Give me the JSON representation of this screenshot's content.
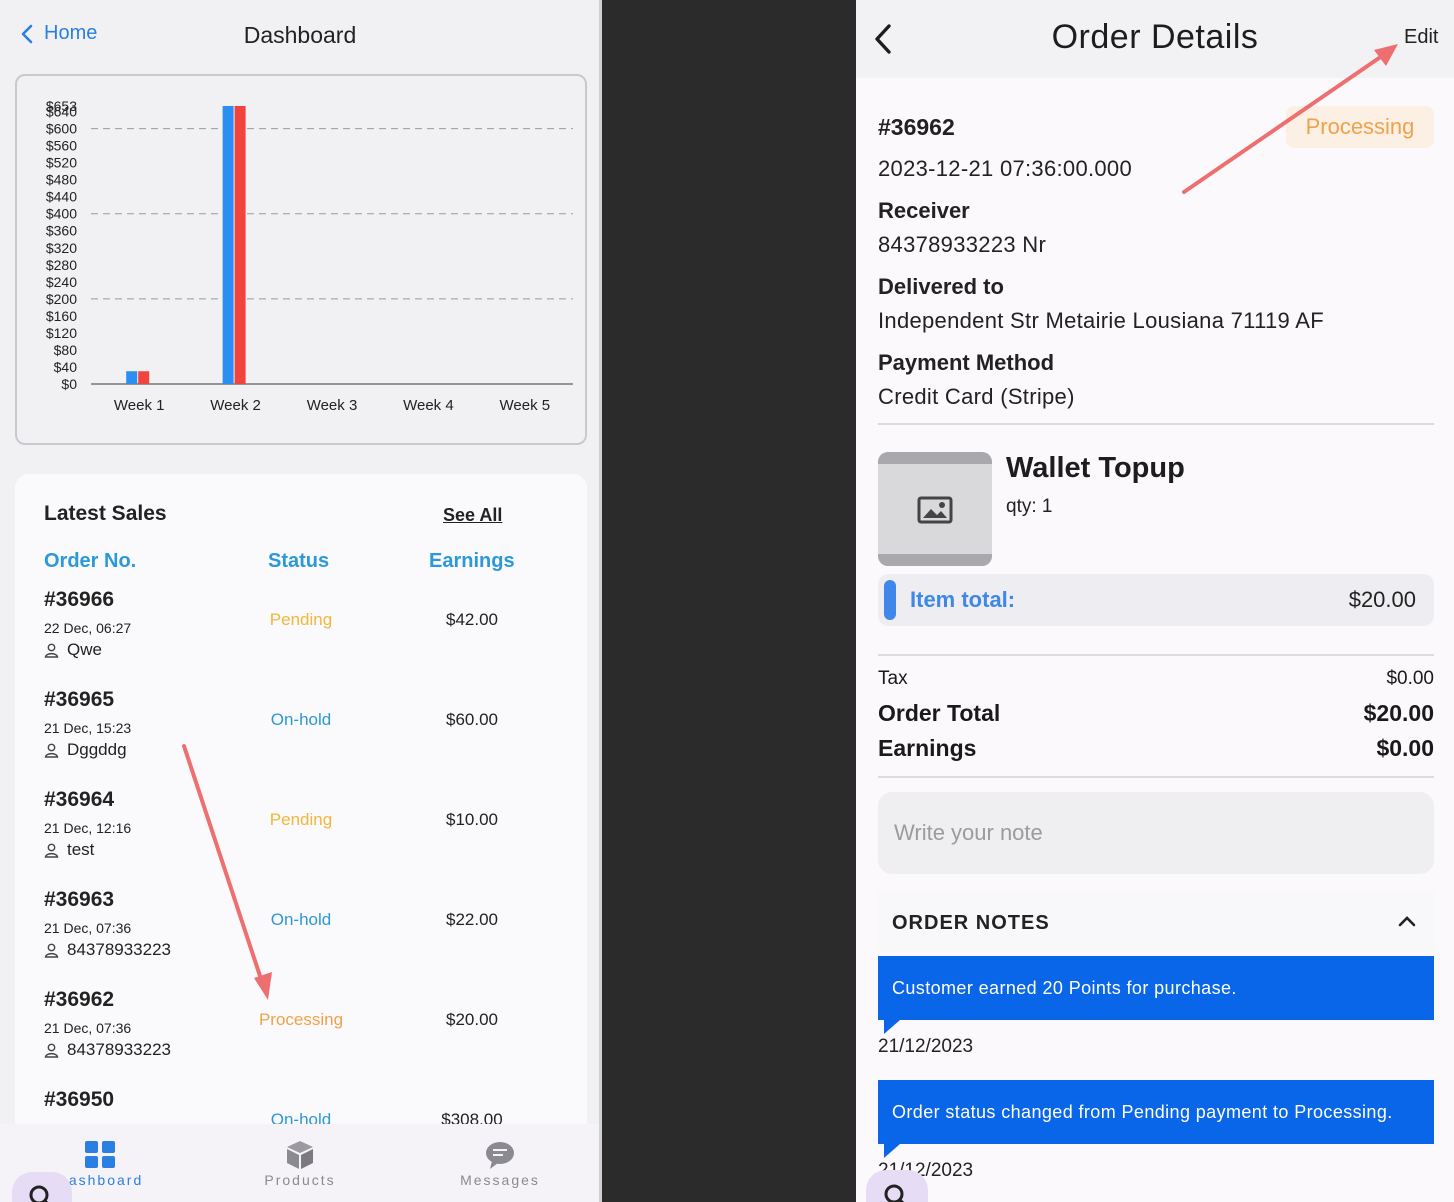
{
  "left": {
    "header": {
      "back_label": "Home",
      "title": "Dashboard"
    },
    "chart_data": {
      "type": "bar",
      "categories": [
        "Week 1",
        "Week 2",
        "Week 3",
        "Week 4",
        "Week 5"
      ],
      "series": [
        {
          "values": [
            30,
            653,
            0,
            0,
            0
          ],
          "color": "#2b8ef0"
        },
        {
          "values": [
            30,
            653,
            0,
            0,
            0
          ],
          "color": "#f0443c"
        }
      ],
      "y_ticks": [
        "$0",
        "$40",
        "$80",
        "$120",
        "$160",
        "$200",
        "$240",
        "$280",
        "$320",
        "$360",
        "$400",
        "$440",
        "$480",
        "$520",
        "$560",
        "$600",
        "$640",
        "$653"
      ],
      "ylim": [
        0,
        653
      ],
      "grid": "dashed at $200, $400, $600"
    },
    "sales": {
      "title": "Latest Sales",
      "see_all": "See All",
      "columns": {
        "order": "Order No.",
        "status": "Status",
        "earnings": "Earnings"
      },
      "rows": [
        {
          "id": "#36966",
          "date": "22 Dec, 06:27",
          "customer": "Qwe",
          "status": "Pending",
          "status_color": "#f2b63a",
          "earnings": "$42.00"
        },
        {
          "id": "#36965",
          "date": "21 Dec, 15:23",
          "customer": "Dggddg",
          "status": "On-hold",
          "status_color": "#2b98d9",
          "earnings": "$60.00"
        },
        {
          "id": "#36964",
          "date": "21 Dec, 12:16",
          "customer": "test",
          "status": "Pending",
          "status_color": "#f2b63a",
          "earnings": "$10.00"
        },
        {
          "id": "#36963",
          "date": "21 Dec, 07:36",
          "customer": "84378933223",
          "status": "On-hold",
          "status_color": "#2b98d9",
          "earnings": "$22.00"
        },
        {
          "id": "#36962",
          "date": "21 Dec, 07:36",
          "customer": "84378933223",
          "status": "Processing",
          "status_color": "#f0a24a",
          "earnings": "$20.00"
        },
        {
          "id": "#36950",
          "date": "",
          "customer": "",
          "status": "On-hold",
          "status_color": "#2b98d9",
          "earnings": "$308.00"
        }
      ]
    },
    "tabs": [
      {
        "label": "Dashboard",
        "icon": "grid-icon"
      },
      {
        "label": "Products",
        "icon": "box-icon"
      },
      {
        "label": "Messages",
        "icon": "chat-icon"
      }
    ]
  },
  "right": {
    "header": {
      "title": "Order Details",
      "edit_label": "Edit"
    },
    "order": {
      "number": "#36962",
      "status": "Processing",
      "datetime": "2023-12-21 07:36:00.000",
      "receiver_label": "Receiver",
      "receiver": "84378933223 Nr",
      "delivered_label": "Delivered to",
      "delivered": "Independent Str Metairie Lousiana 71119 AF",
      "payment_label": "Payment Method",
      "payment": "Credit Card (Stripe)"
    },
    "product": {
      "name": "Wallet Topup",
      "qty": "qty: 1",
      "item_total_label": "Item total:",
      "item_total": "$20.00"
    },
    "summary": {
      "tax_label": "Tax",
      "tax": "$0.00",
      "total_label": "Order Total",
      "total": "$20.00",
      "earnings_label": "Earnings",
      "earnings": "$0.00"
    },
    "note_placeholder": "Write your note",
    "notes": {
      "title": "ORDER NOTES",
      "items": [
        {
          "text": "Customer earned 20 Points for purchase.",
          "date": "21/12/2023"
        },
        {
          "text": "Order status changed from Pending payment to Processing.",
          "date": "21/12/2023"
        }
      ]
    }
  },
  "colors": {
    "accent_blue": "#2b7fe0",
    "note_blue": "#0a66e8",
    "annotation_arrow": "#ee6f6f"
  }
}
